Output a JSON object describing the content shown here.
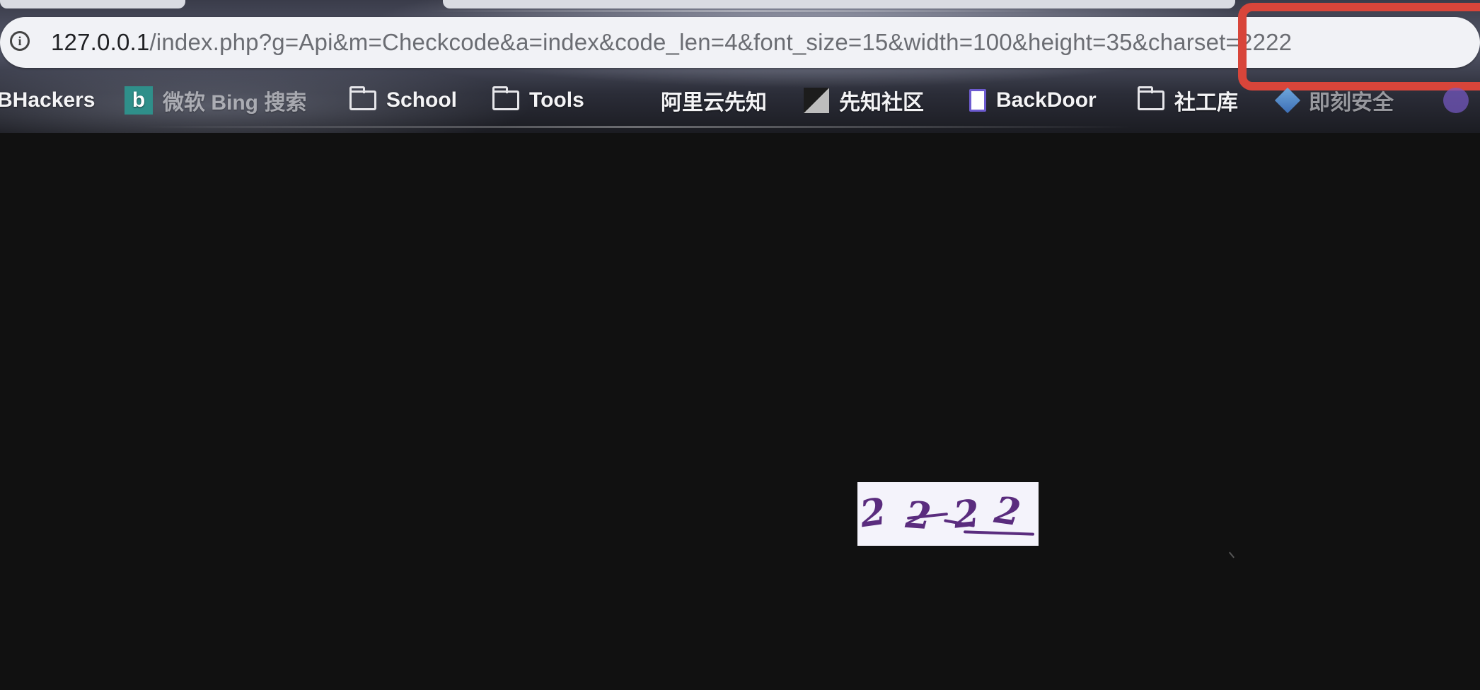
{
  "browser": {
    "address_bar": {
      "icon": "info-icon",
      "url_host": "127.0.0.1",
      "url_path": "/index.php?g=Api&m=Checkcode&a=index&code_len=4&font_size=15&width=100&height=35&charset=2222",
      "annotation_color": "#d8453a"
    },
    "bookmarks": [
      {
        "label": "BHackers",
        "icon": "none"
      },
      {
        "label": "微软 Bing 搜索",
        "icon": "bing-icon"
      },
      {
        "label": "School",
        "icon": "folder-icon"
      },
      {
        "label": "Tools",
        "icon": "folder-icon"
      },
      {
        "label": "阿里云先知",
        "icon": "none"
      },
      {
        "label": "先知社区",
        "icon": "xianzhi-icon"
      },
      {
        "label": "BackDoor",
        "icon": "document-icon"
      },
      {
        "label": "社工库",
        "icon": "folder-icon"
      },
      {
        "label": "即刻安全",
        "icon": "cube-icon"
      }
    ]
  },
  "page": {
    "background": "#111111",
    "captcha": {
      "characters": [
        "2",
        "2",
        "2",
        "2"
      ],
      "color": "#5a2c7e",
      "background": "#f4f3fb"
    }
  }
}
